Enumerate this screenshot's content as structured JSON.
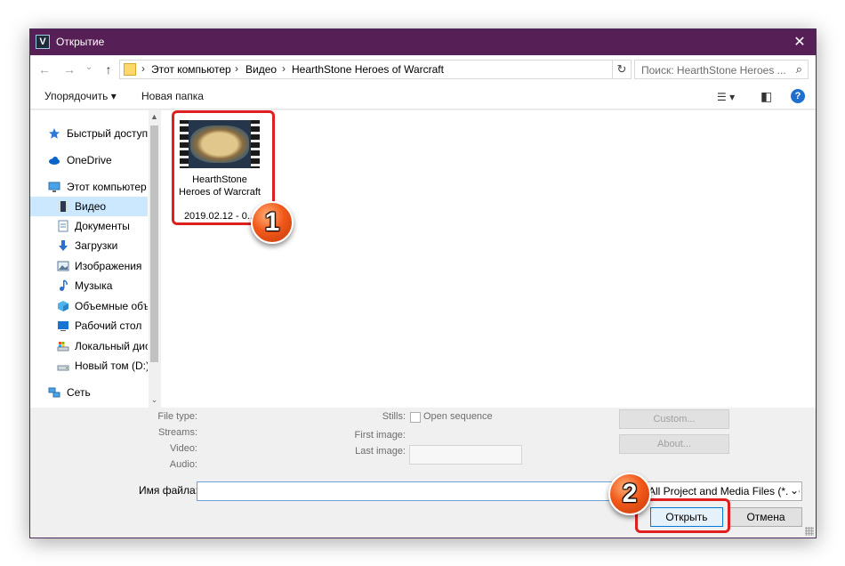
{
  "window": {
    "title": "Открытие",
    "app_icon_letter": "V",
    "close_glyph": "✕"
  },
  "address_bar": {
    "nav_back": "←",
    "nav_forward": "→",
    "nav_recent": "⌄",
    "nav_up": "↑",
    "breadcrumbs": [
      "Этот компьютер",
      "Видео",
      "HearthStone  Heroes of Warcraft"
    ],
    "separator": "›",
    "dropdown_glyph": "⌄",
    "refresh_glyph": "↻",
    "search_placeholder": "Поиск: HearthStone  Heroes ...",
    "search_glyph": "⌕"
  },
  "toolbar": {
    "organize_label": "Упорядочить ▾",
    "new_folder_label": "Новая папка",
    "view_menu_glyph": "☰ ▾",
    "preview_pane_glyph": "◧",
    "help_glyph": "?"
  },
  "nav_pane": {
    "items": [
      {
        "label": "Быстрый доступ",
        "icon": "star-icon",
        "selected": false
      },
      {
        "label": "OneDrive",
        "icon": "cloud-icon",
        "selected": false
      },
      {
        "label": "Этот компьютер",
        "icon": "computer-icon",
        "selected": false
      },
      {
        "label": "Видео",
        "icon": "video-folder-icon",
        "selected": true
      },
      {
        "label": "Документы",
        "icon": "documents-icon",
        "selected": false
      },
      {
        "label": "Загрузки",
        "icon": "downloads-icon",
        "selected": false
      },
      {
        "label": "Изображения",
        "icon": "pictures-icon",
        "selected": false
      },
      {
        "label": "Музыка",
        "icon": "music-icon",
        "selected": false
      },
      {
        "label": "Объемные объ",
        "icon": "3d-objects-icon",
        "selected": false
      },
      {
        "label": "Рабочий стол",
        "icon": "desktop-icon",
        "selected": false
      },
      {
        "label": "Локальный дис",
        "icon": "local-disk-icon",
        "selected": false
      },
      {
        "label": "Новый том (D:)",
        "icon": "drive-icon",
        "selected": false
      },
      {
        "label": "Сеть",
        "icon": "network-icon",
        "selected": false
      }
    ],
    "scroll_up": "▲",
    "scroll_down": "⌄"
  },
  "files": [
    {
      "name": "HearthStone Heroes of Warcraft",
      "date": "2019.02.12 - 0..."
    }
  ],
  "callouts": [
    "1",
    "2"
  ],
  "info": {
    "file_type_label": "File type:",
    "streams_label": "Streams:",
    "video_label": "Video:",
    "audio_label": "Audio:",
    "stills_label": "Stills:",
    "open_sequence_label": "Open sequence",
    "first_image_label": "First image:",
    "last_image_label": "Last image:",
    "custom_button": "Custom...",
    "about_button": "About..."
  },
  "footer": {
    "filename_label": "Имя файла:",
    "filename_value": "",
    "filter_value": "All Project and Media Files (*.ve",
    "filter_dropdown_glyph": "⌄",
    "open_button": "Открыть",
    "cancel_button": "Отмена"
  },
  "colors": {
    "titlebar": "#561f55",
    "selection": "#cce8ff",
    "highlight": "#e01f1f",
    "callout": "#f2591a"
  }
}
